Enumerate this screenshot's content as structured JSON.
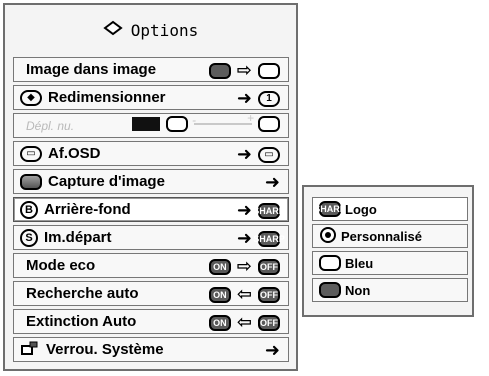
{
  "menu": {
    "title": "Options",
    "rows": [
      {
        "label": "Image dans image"
      },
      {
        "label": "Redimensionner"
      },
      {
        "label": "Dépl. nu."
      },
      {
        "label": "Af.OSD"
      },
      {
        "label": "Capture d'image"
      },
      {
        "label": "Arrière-fond"
      },
      {
        "label": "Im.départ"
      },
      {
        "label": "Mode eco"
      },
      {
        "label": "Recherche auto"
      },
      {
        "label": "Extinction Auto"
      },
      {
        "label": "Verrou. Système"
      }
    ]
  },
  "submenu": {
    "items": [
      {
        "label": "Logo"
      },
      {
        "label": "Personnalisé"
      },
      {
        "label": "Bleu"
      },
      {
        "label": "Non"
      }
    ]
  },
  "icons": {
    "title": "options-icon",
    "selected_accent": "#ffffff"
  }
}
